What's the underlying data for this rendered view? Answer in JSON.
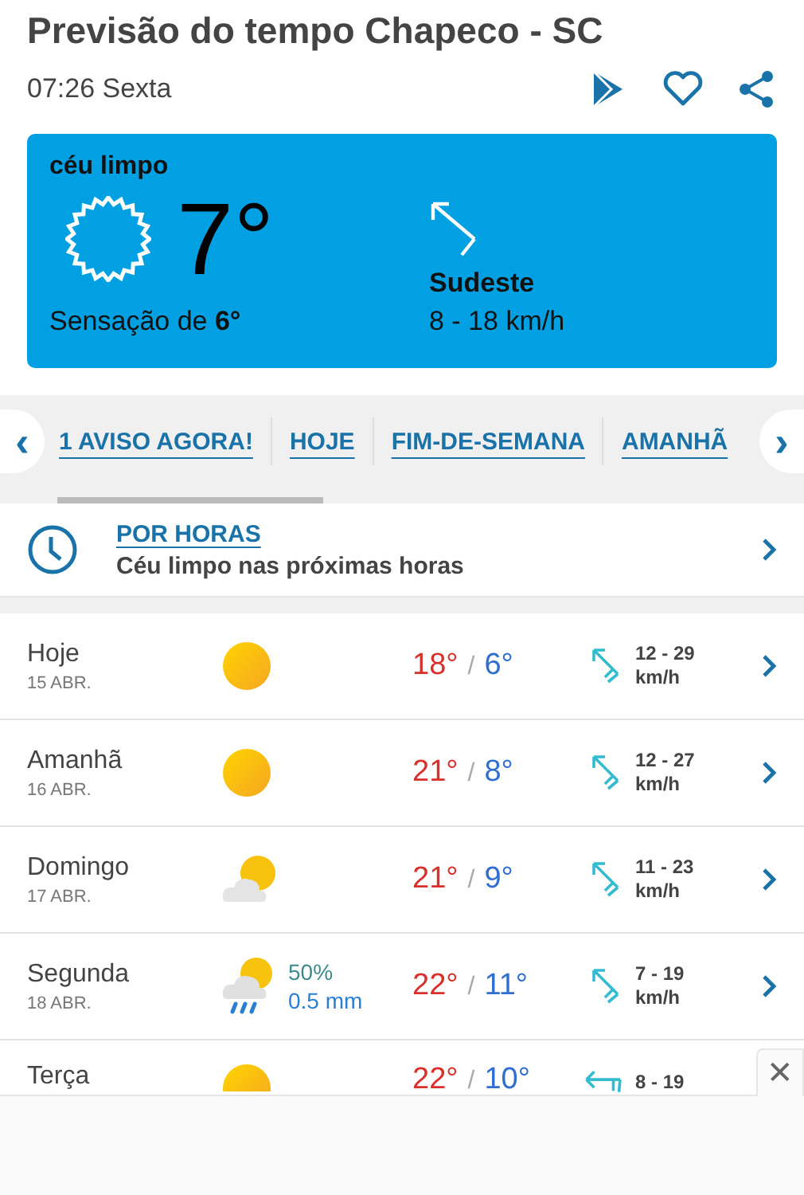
{
  "header": {
    "title": "Previsão do tempo Chapeco - SC",
    "time": "07:26 Sexta"
  },
  "current": {
    "condition": "céu limpo",
    "temperature": "7°",
    "feels_label": "Sensação de ",
    "feels_value": "6°",
    "wind_name": "Sudeste",
    "wind_speed": "8 - 18 km/h"
  },
  "nav": {
    "links": [
      "1 AVISO AGORA!",
      "HOJE",
      "FIM-DE-SEMANA",
      "AMANHÃ"
    ],
    "prev": "‹",
    "next": "›"
  },
  "hourly": {
    "title": "POR HORAS",
    "subtitle": "Céu limpo nas próximas horas"
  },
  "days": [
    {
      "name": "Hoje",
      "date": "15 ABR.",
      "kind": "sun",
      "high": "18°",
      "separator": "/",
      "low": "6°",
      "wind": {
        "kind": "se",
        "speed": "12 - 29",
        "unit": "km/h"
      }
    },
    {
      "name": "Amanhã",
      "date": "16 ABR.",
      "kind": "sun",
      "high": "21°",
      "separator": "/",
      "low": "8°",
      "wind": {
        "kind": "se",
        "speed": "12 - 27",
        "unit": "km/h"
      }
    },
    {
      "name": "Domingo",
      "date": "17 ABR.",
      "kind": "partly-cloudy",
      "high": "21°",
      "separator": "/",
      "low": "9°",
      "wind": {
        "kind": "se",
        "speed": "11 - 23",
        "unit": "km/h"
      }
    },
    {
      "name": "Segunda",
      "date": "18 ABR.",
      "kind": "rain",
      "rain_chance": "50%",
      "rain_amount": "0.5 mm",
      "high": "22°",
      "separator": "/",
      "low": "11°",
      "wind": {
        "kind": "se",
        "speed": "7 - 19",
        "unit": "km/h"
      }
    },
    {
      "name": "Terça",
      "kind": "sun",
      "high": "22°",
      "separator": "/",
      "low": "10°",
      "wind": {
        "kind": "e",
        "speed": "8 - 19"
      }
    }
  ],
  "ad": {
    "close": "✕"
  }
}
